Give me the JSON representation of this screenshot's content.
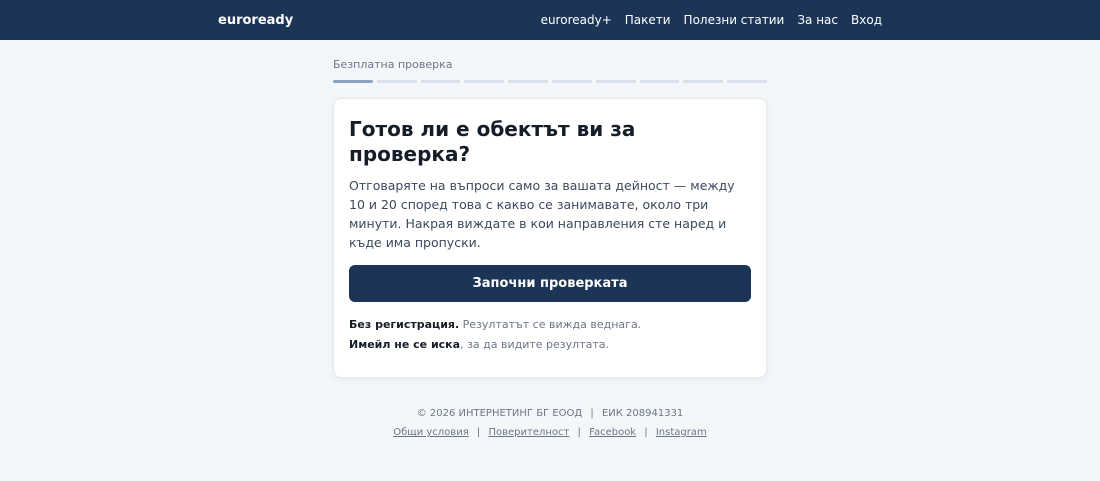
{
  "header": {
    "brand": "euroready",
    "nav": [
      "euroready+",
      "Пакети",
      "Полезни статии",
      "За нас",
      "Вход"
    ]
  },
  "quiz": {
    "step_label": "Безплатна проверка",
    "progress_segments": 10,
    "progress_current": 1
  },
  "card": {
    "title": "Готов ли е обектът ви за проверка?",
    "lead": "Отговаряте на въпроси само за вашата дейност — между 10 и 20 според това с какво се занимавате, около три минути. Накрая виждате в кои направления сте наред и къде има пропуски.",
    "start_button": "Започни проверката",
    "note1_bold": "Без регистрация.",
    "note1_text": " Резултатът се вижда веднага.",
    "note2_bold": "Имейл не се иска",
    "note2_text": ", за да видите резултата."
  },
  "footer": {
    "copyright": "© 2026 ИНТЕРНЕТИНГ БГ ЕООД",
    "company_id": "ЕИК 208941331",
    "separator": "|",
    "links": [
      "Общи условия",
      "Поверителност",
      "Facebook",
      "Instagram"
    ]
  },
  "colors": {
    "header_bg": "#1c3557",
    "button_bg": "#1c3557",
    "page_bg": "#f4f7fa",
    "progress_active": "#8aa2c0",
    "progress_inactive": "#d8e0ea"
  }
}
